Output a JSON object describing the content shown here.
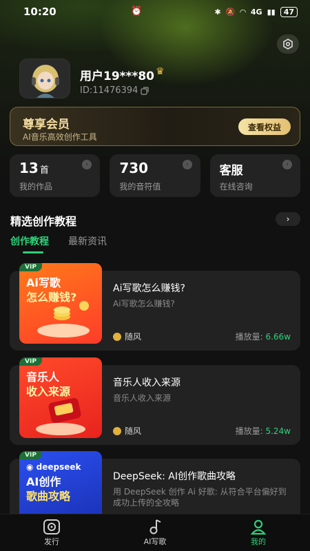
{
  "status": {
    "time": "10:20",
    "battery": "47",
    "signal": "4G"
  },
  "profile": {
    "username": "用户19***80",
    "id_text": "ID:11476394"
  },
  "vip": {
    "title": "尊享会员",
    "subtitle": "AI音乐高效创作工具",
    "button": "查看权益"
  },
  "stats": [
    {
      "value": "13",
      "unit": "首",
      "label": "我的作品"
    },
    {
      "value": "730",
      "unit": "",
      "label": "我的音符值"
    },
    {
      "value": "客服",
      "unit": "",
      "label": "在线咨询"
    }
  ],
  "section": {
    "title": "精选创作教程",
    "tabs": [
      "创作教程",
      "最新资讯"
    ]
  },
  "articles": [
    {
      "thumb_badge": "VIP",
      "thumb_line1": "Ai写歌",
      "thumb_line2": "怎么赚钱?",
      "title": "Ai写歌怎么赚钱?",
      "subtitle": "Ai写歌怎么赚钱?",
      "author": "随风",
      "plays_label": "播放量:",
      "plays": "6.66w"
    },
    {
      "thumb_badge": "VIP",
      "thumb_line1": "音乐人",
      "thumb_line2": "收入来源",
      "title": "音乐人收入来源",
      "subtitle": "音乐人收入来源",
      "author": "随风",
      "plays_label": "播放量:",
      "plays": "5.24w"
    },
    {
      "thumb_badge": "VIP",
      "thumb_brand": "deepseek",
      "thumb_line1": "AI创作",
      "thumb_line2": "歌曲攻略",
      "title": "DeepSeek: AI创作歌曲攻略",
      "subtitle": "用 DeepSeek 创作 Ai 好歌: 从符合平台偏好到成功上传的全攻略"
    }
  ],
  "nav": [
    {
      "label": "发行",
      "icon": "publish-icon"
    },
    {
      "label": "AI写歌",
      "icon": "music-note-icon"
    },
    {
      "label": "我的",
      "icon": "user-icon"
    }
  ],
  "colors": {
    "accent": "#2fd17a",
    "gold": "#f4dca0",
    "card": "#222222"
  }
}
